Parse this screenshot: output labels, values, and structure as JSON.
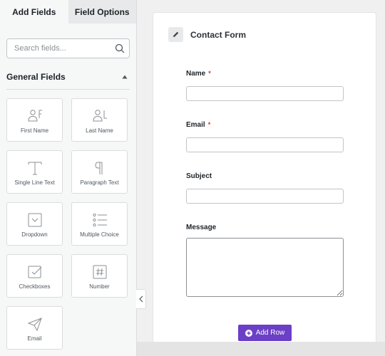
{
  "sidebar": {
    "tabs": [
      {
        "label": "Add Fields",
        "active": true
      },
      {
        "label": "Field Options",
        "active": false
      }
    ],
    "search": {
      "placeholder": "Search fields..."
    },
    "section_title": "General Fields",
    "fields": [
      {
        "label": "First Name",
        "icon": "person-first-name-icon"
      },
      {
        "label": "Last Name",
        "icon": "person-last-name-icon"
      },
      {
        "label": "Single Line Text",
        "icon": "text-t-icon"
      },
      {
        "label": "Paragraph Text",
        "icon": "paragraph-icon"
      },
      {
        "label": "Dropdown",
        "icon": "dropdown-icon"
      },
      {
        "label": "Multiple Choice",
        "icon": "multiple-choice-list-icon"
      },
      {
        "label": "Checkboxes",
        "icon": "checkbox-icon"
      },
      {
        "label": "Number",
        "icon": "hash-icon"
      },
      {
        "label": "Email",
        "icon": "paper-plane-icon"
      }
    ]
  },
  "form": {
    "title": "Contact Form",
    "fields": [
      {
        "label": "Name",
        "required": "*"
      },
      {
        "label": "Email",
        "required": "*"
      },
      {
        "label": "Subject",
        "required": ""
      },
      {
        "label": "Message",
        "required": ""
      }
    ],
    "add_row_label": "Add Row"
  },
  "colors": {
    "accent": "#6b3fc6",
    "required": "#d63638",
    "sidebar_bg": "#f6f7f7",
    "page_bg": "#f0f0f1"
  }
}
